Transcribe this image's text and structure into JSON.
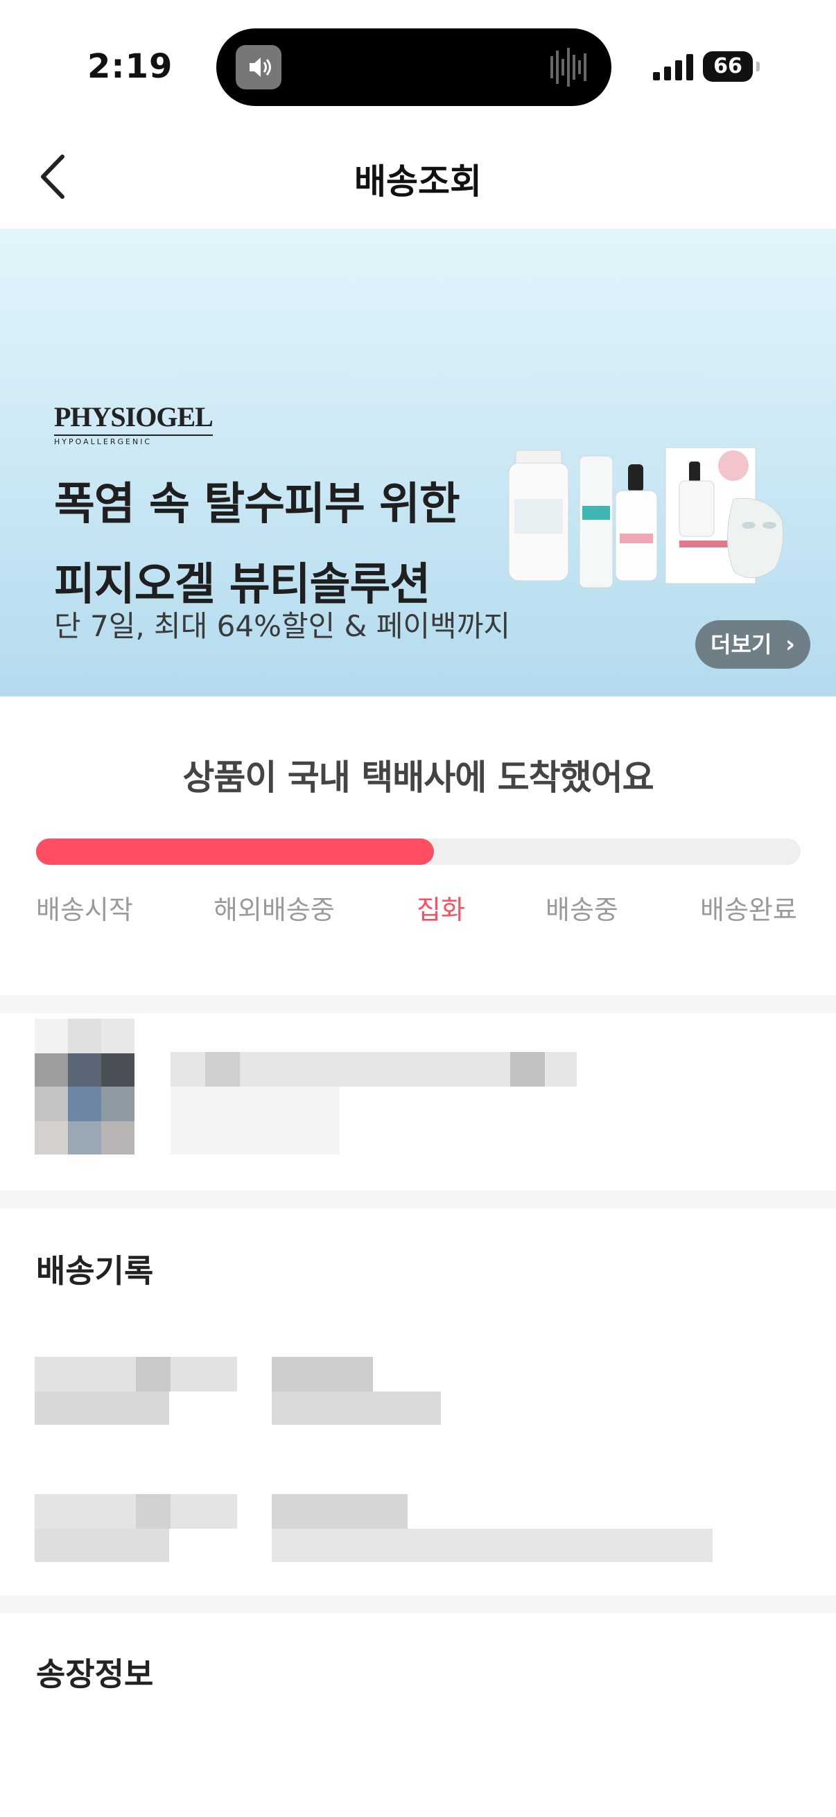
{
  "status_bar": {
    "time": "2:19",
    "battery": "66"
  },
  "nav": {
    "title": "배송조회"
  },
  "banner": {
    "brand": "PHYSIOGEL",
    "brand_sub": "HYPOALLERGENIC",
    "headline_line1": "폭염 속 탈수피부 위한",
    "headline_line2": "피지오겔 뷰티솔루션",
    "subtext": "단 7일, 최대 64%할인 & 페이백까지",
    "more_label": "더보기",
    "background_color": "#c9e7f4",
    "button_color": "#6f7f88"
  },
  "delivery_status": {
    "message": "상품이 국내 택배사에 도착했어요",
    "progress": 0.52,
    "accent_color": "#ff4e62",
    "steps": [
      "배송시작",
      "해외배송중",
      "집화",
      "배송중",
      "배송완료"
    ],
    "active_step": 2
  },
  "sections": {
    "history_title": "배송기록",
    "invoice_title": "송장정보"
  }
}
